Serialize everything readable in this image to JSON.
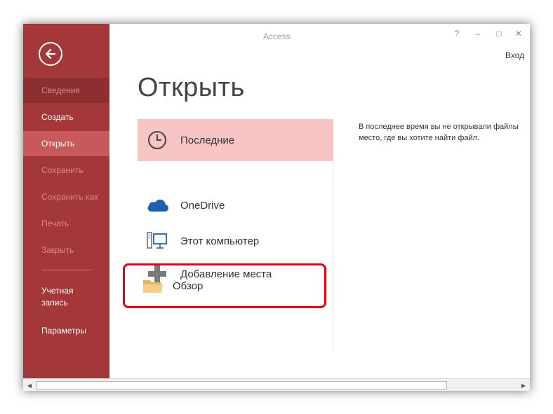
{
  "app": {
    "title": "Access",
    "signin": "Вход"
  },
  "window_controls": {
    "help": "?",
    "minimize": "–",
    "maximize": "□",
    "close": "✕"
  },
  "sidebar": {
    "items": [
      {
        "label": "Сведения",
        "state": "info"
      },
      {
        "label": "Создать",
        "state": "normal"
      },
      {
        "label": "Открыть",
        "state": "active"
      },
      {
        "label": "Сохранить",
        "state": "disabled"
      },
      {
        "label": "Сохранить как",
        "state": "disabled"
      },
      {
        "label": "Печать",
        "state": "disabled"
      },
      {
        "label": "Закрыть",
        "state": "disabled"
      },
      {
        "label": "Учетная\nзапись",
        "state": "normal"
      },
      {
        "label": "Параметры",
        "state": "normal"
      }
    ]
  },
  "main": {
    "title": "Открыть",
    "places": [
      {
        "label": "Последние",
        "icon": "clock-icon",
        "selected": true
      },
      {
        "label": "OneDrive",
        "icon": "onedrive-cloud-icon"
      },
      {
        "label": "Этот компьютер",
        "icon": "computer-icon"
      },
      {
        "label": "Добавление места",
        "icon": "plus-icon"
      },
      {
        "label": "Обзор",
        "icon": "folder-icon",
        "highlighted": true
      }
    ],
    "info_text": "В последнее время вы не открывали файлы\nместо, где вы хотите найти файл."
  },
  "colors": {
    "sidebar": "#a4373a",
    "sidebar_active": "#c7595c",
    "selected_place": "#f8c4c4",
    "highlight_outline": "#e0001a",
    "onedrive_blue": "#1e5fb4"
  }
}
